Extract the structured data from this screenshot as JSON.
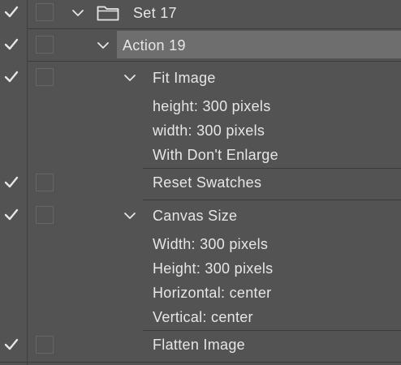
{
  "set": {
    "label": "Set 17",
    "enabled": true,
    "expanded": true
  },
  "action": {
    "label": "Action 19",
    "enabled": true,
    "expanded": true,
    "selected": true
  },
  "steps": [
    {
      "label": "Fit Image",
      "enabled": true,
      "expanded": true,
      "params": [
        "height: 300 pixels",
        "width: 300 pixels",
        "With Don't Enlarge"
      ]
    },
    {
      "label": "Reset Swatches",
      "enabled": true,
      "expanded": false,
      "params": []
    },
    {
      "label": "Canvas Size",
      "enabled": true,
      "expanded": true,
      "params": [
        "Width: 300 pixels",
        "Height: 300 pixels",
        "Horizontal: center",
        "Vertical: center"
      ]
    },
    {
      "label": "Flatten Image",
      "enabled": true,
      "expanded": false,
      "params": []
    }
  ],
  "icons": {
    "check": "checkmark-icon",
    "expand": "chevron-down-icon",
    "folder": "folder-icon"
  },
  "colors": {
    "panel_bg": "#535353",
    "selected_row_bg": "#6e6e6e",
    "text": "#e6e6e6"
  }
}
